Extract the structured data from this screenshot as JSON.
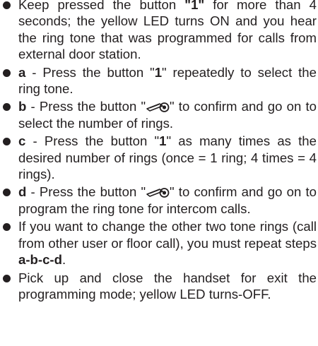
{
  "items": [
    {
      "parts": [
        {
          "t": "Keep pressed the button "
        },
        {
          "t": "\"1\"",
          "b": true
        },
        {
          "t": " for more than 4 seconds; the yellow LED turns ON and you hear the ring tone that was programmed for calls from external door station."
        }
      ]
    },
    {
      "parts": [
        {
          "t": "a",
          "b": true
        },
        {
          "t": " - Press the button \""
        },
        {
          "t": "1",
          "b": true
        },
        {
          "t": "\" repeatedly to select the ring tone."
        }
      ]
    },
    {
      "parts": [
        {
          "t": "b",
          "b": true
        },
        {
          "t": " - Press the button \""
        },
        {
          "icon": "key-icon"
        },
        {
          "t": "\" to confirm and go on to select the number of rings."
        }
      ]
    },
    {
      "parts": [
        {
          "t": "c",
          "b": true
        },
        {
          "t": " - Press the button \""
        },
        {
          "t": "1",
          "b": true
        },
        {
          "t": "\" as many times as the desired number of rings (once = 1 ring; 4 times = 4 rings)."
        }
      ]
    },
    {
      "parts": [
        {
          "t": "d",
          "b": true
        },
        {
          "t": " - Press the button \""
        },
        {
          "icon": "key-icon"
        },
        {
          "t": "\" to confirm and go on to program the ring tone for intercom calls."
        }
      ]
    },
    {
      "parts": [
        {
          "t": "If you want to change the other two tone rings (call from other user or floor call), you must repeat steps "
        },
        {
          "t": "a-b-c-d",
          "b": true
        },
        {
          "t": "."
        }
      ]
    },
    {
      "parts": [
        {
          "t": "Pick up and close the handset for exit the programming mode; yellow LED turns-OFF."
        }
      ]
    }
  ]
}
